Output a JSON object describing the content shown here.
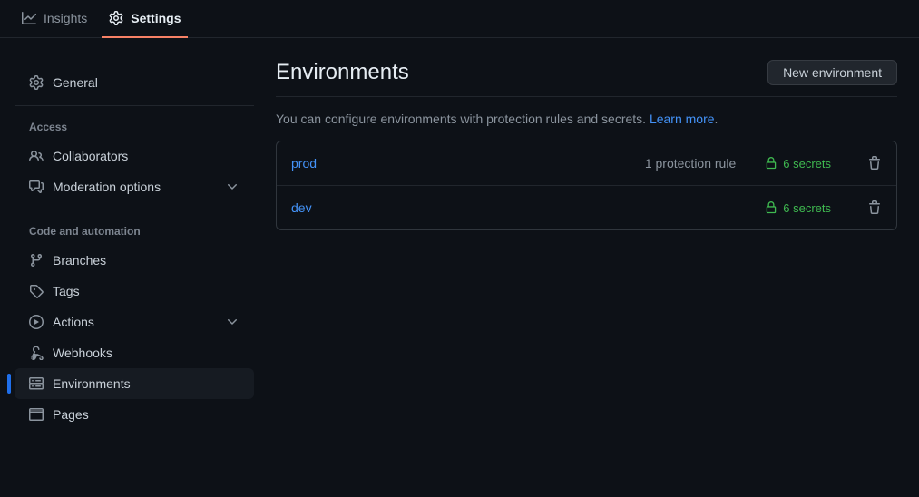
{
  "tabs": {
    "insights": "Insights",
    "settings": "Settings"
  },
  "sidebar": {
    "general": "General",
    "access_heading": "Access",
    "collaborators": "Collaborators",
    "moderation": "Moderation options",
    "code_heading": "Code and automation",
    "branches": "Branches",
    "tags": "Tags",
    "actions": "Actions",
    "webhooks": "Webhooks",
    "environments": "Environments",
    "pages": "Pages"
  },
  "main": {
    "title": "Environments",
    "new_button": "New environment",
    "description_prefix": "You can configure environments with protection rules and secrets. ",
    "learn_more": "Learn more",
    "description_suffix": "."
  },
  "environments": [
    {
      "name": "prod",
      "protection": "1 protection rule",
      "secrets": "6 secrets"
    },
    {
      "name": "dev",
      "protection": "",
      "secrets": "6 secrets"
    }
  ]
}
